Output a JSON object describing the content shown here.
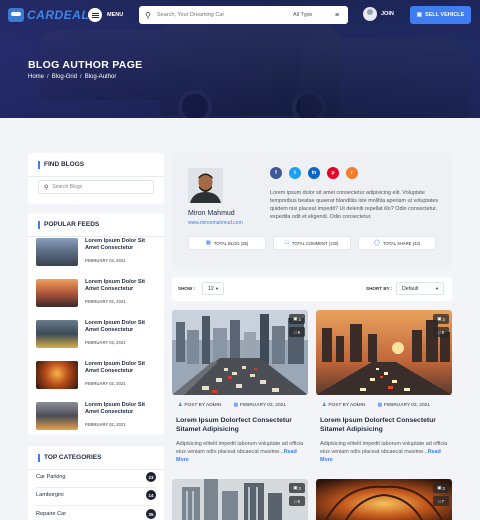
{
  "header": {
    "logo_text": "CARDEAL",
    "menu_label": "MENU",
    "search_placeholder": "Search, Your Dreaming Car",
    "type_select": "All Type",
    "join_label": "JOIN",
    "sell_button": "SELL VEHICLE"
  },
  "hero": {
    "title": "BLOG AUTHOR PAGE",
    "breadcrumbs": [
      "Home",
      "Blog-Grid",
      "Blog-Author"
    ]
  },
  "sidebar": {
    "find_blogs": {
      "title": "FIND BLOGS",
      "placeholder": "Search Blogs"
    },
    "popular_feeds": {
      "title": "POPULAR FEEDS",
      "items": [
        {
          "title": "Lorem Ipsum Dolor Sit Amet Consectetur",
          "date": "FEBRUARY 02, 2021"
        },
        {
          "title": "Lorem Ipsum Dolor Sit Amet Consectetur",
          "date": "FEBRUARY 02, 2021"
        },
        {
          "title": "Lorem Ipsum Dolor Sit Amet Consectetur",
          "date": "FEBRUARY 02, 2021"
        },
        {
          "title": "Lorem Ipsum Dolor Sit Amet Consectetur",
          "date": "FEBRUARY 02, 2021"
        },
        {
          "title": "Lorem Ipsum Dolor Sit Amet Consectetur",
          "date": "FEBRUARY 02, 2021"
        }
      ]
    },
    "top_categories": {
      "title": "TOP CATEGORIES",
      "items": [
        {
          "name": "Car Parking",
          "count": "23"
        },
        {
          "name": "Lamborgini",
          "count": "14"
        },
        {
          "name": "Repaire Car",
          "count": "35"
        }
      ]
    }
  },
  "author": {
    "name": "Miron Mahmud",
    "website": "www.mironmahmud.com",
    "bio": "Lorem ipsum dolor sit amet consectetur adipisicing elit. Voluptate temporibus beatae quaerat blanditiis iste mollitia aperiam ut voluptates quidem nisi placeat impedit? Ut deleniti repellat illo? Odio consectetur, expedita odit et eligendi. Odio consectetur.",
    "socials": [
      {
        "icon": "facebook-icon",
        "glyph": "f",
        "color": "#3b5998"
      },
      {
        "icon": "twitter-icon",
        "glyph": "t",
        "color": "#1da1f2"
      },
      {
        "icon": "linkedin-icon",
        "glyph": "in",
        "color": "#0a66c2"
      },
      {
        "icon": "pinterest-icon",
        "glyph": "p",
        "color": "#e60023"
      },
      {
        "icon": "rss-icon",
        "glyph": "r",
        "color": "#f57c2b"
      }
    ],
    "stats": [
      {
        "label": "TOTAL BLOG (25)"
      },
      {
        "label": "TOTAL COMMENT (130)"
      },
      {
        "label": "TOTAL SHARE (43)"
      }
    ]
  },
  "controls": {
    "show_label": "SHOW :",
    "show_value": "12",
    "sort_label": "SHORT BY :",
    "sort_value": "Default"
  },
  "posts": [
    {
      "author": "POST BY ADMIN",
      "date": "FEBRUARY 02, 2021",
      "title": "Lorem Ipsum Dolorfect Consectetur Sitamet Adipisicing",
      "excerpt": "Adipisicing elitelit impedit laborum voluptate ad officia eius veniam odio placeat obcaecat maxime...",
      "read_more": "Read More",
      "badges": [
        "3",
        "9"
      ]
    },
    {
      "author": "POST BY ADMIN",
      "date": "FEBRUARY 02, 2021",
      "title": "Lorem Ipsum Dolorfect Consectetur Sitamet Adipisicing",
      "excerpt": "Adipisicing elitelit impedit laborum voluptate ad officia eius veniam odio placeat obcaecat maxime...",
      "read_more": "Read More",
      "badges": [
        "3",
        "9"
      ]
    },
    {
      "badges": [
        "3",
        "9"
      ]
    },
    {
      "badges": [
        "3",
        "7"
      ]
    }
  ],
  "colors": {
    "accent": "#3e7ef0",
    "hero_bg": "#1e2a5a",
    "page_bg": "#f3f4f7"
  }
}
